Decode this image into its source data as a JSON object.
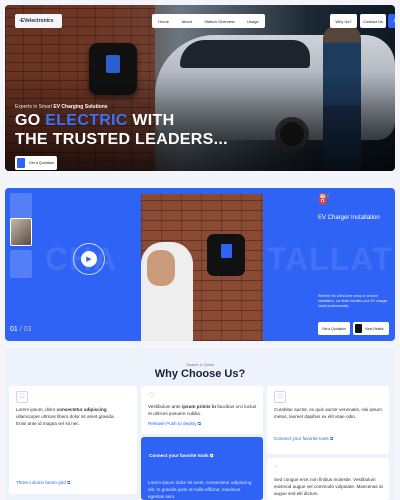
{
  "nav": {
    "logo": "EVelectronics",
    "menu": [
      "Home",
      "About",
      "Station Overview",
      "Usage"
    ],
    "why_us": "Why Us?",
    "contact": "Contact Us"
  },
  "hero": {
    "subtitle_pre": "Experts in Smart",
    "subtitle_bold": "EV Charging Solutions",
    "title_line1_a": "GO",
    "title_line1_b": "ELECTRIC",
    "title_line1_c": "WITH",
    "title_line2": "THE TRUSTED LEADERS...",
    "cta": "Get a Quotation"
  },
  "showcase": {
    "counter_current": "01",
    "counter_total": "/ 03",
    "bg_left": "CHA",
    "bg_right": "TALLAT",
    "feature_title": "EV Charger Installation",
    "feature_desc": "Whether it's a first-time setup or a home installation, our team handles your EV charger install professionally.",
    "btn_primary": "Get a Quotation",
    "btn_secondary": "View Details"
  },
  "why": {
    "subtitle": "Search & Quick",
    "title": "Why Choose Us?",
    "cards": [
      {
        "text_a": "Lorem ipsum, dolor",
        "text_bold": "consectetur adipiscing",
        "text_b": "ullamcorper ultrices libero dolor sit amet gravida. Enim ante id magna vel sit nec.",
        "link": "Three column bento grid"
      },
      {
        "text_a": "Vestibulum ante",
        "text_bold": "ipsum primis in",
        "text_b": "faucibus orci luctus et ultrices posuere cubilia.",
        "link": "Release Push to deploy"
      },
      {
        "text_a": "Curabitur auctor, ex quis auctor venenatis, nisi",
        "text_bold": "",
        "text_b": "ipsum metus, laoreet dapibus ex elit vitae odio.",
        "link": "Connect your favorite tools"
      },
      {
        "head": "Connect your favorite tools",
        "text": "Lorem ipsum dolor sit amet, consectetur adipiscing elit. In gravida justo et nulla efficitur, maximus egestas sem."
      },
      {
        "text": "Sed congue eros non finibus molestie. Vestibulum euismod augue vel commodo vulputate. Maecenas at augue sed elit dictum."
      }
    ]
  }
}
